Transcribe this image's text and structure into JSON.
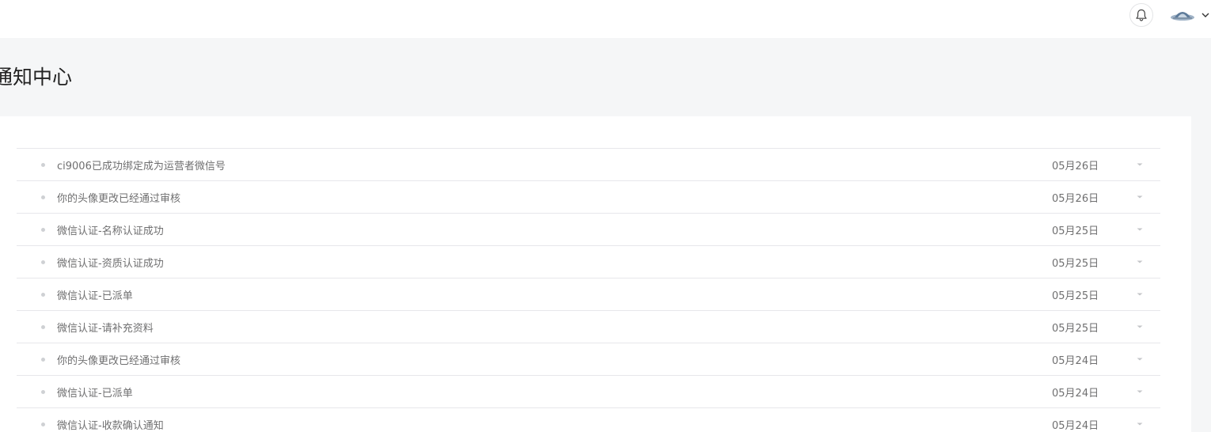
{
  "header": {
    "bell_icon": "bell-icon",
    "avatar_icon": "avatar",
    "menu_icon": "chevron-down-icon"
  },
  "page": {
    "title": "通知中心"
  },
  "notifications": [
    {
      "text": "ci9006已成功绑定成为运营者微信号",
      "date": "05月26日"
    },
    {
      "text": "你的头像更改已经通过审核",
      "date": "05月26日"
    },
    {
      "text": "微信认证-名称认证成功",
      "date": "05月25日"
    },
    {
      "text": "微信认证-资质认证成功",
      "date": "05月25日"
    },
    {
      "text": "微信认证-已派单",
      "date": "05月25日"
    },
    {
      "text": "微信认证-请补充资料",
      "date": "05月25日"
    },
    {
      "text": "你的头像更改已经通过审核",
      "date": "05月24日"
    },
    {
      "text": "微信认证-已派单",
      "date": "05月24日"
    },
    {
      "text": "微信认证-收款确认通知",
      "date": "05月24日"
    }
  ],
  "colors": {
    "page_bg": "#f5f6f7",
    "panel_bg": "#ffffff",
    "text": "#6f6f70",
    "divider": "#e7e7eb"
  }
}
